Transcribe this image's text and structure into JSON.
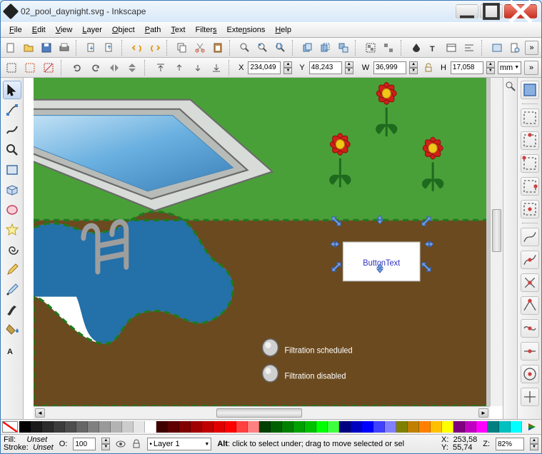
{
  "window": {
    "title": "02_pool_daynight.svg - Inkscape"
  },
  "menu": {
    "file": "File",
    "edit": "Edit",
    "view": "View",
    "layer": "Layer",
    "object": "Object",
    "path": "Path",
    "text": "Text",
    "filters": "Filters",
    "extensions": "Extensions",
    "help": "Help"
  },
  "tc": {
    "x_label": "X",
    "x": "234,049",
    "y_label": "Y",
    "y": "48,243",
    "w_label": "W",
    "w": "36,999",
    "h_label": "H",
    "h": "17,058",
    "unit": "mm"
  },
  "canvas": {
    "button_text": "ButtonText",
    "label1": "Filtration scheduled",
    "label2": "Filtration disabled"
  },
  "status": {
    "fill_label": "Fill:",
    "fill": "Unset",
    "stroke_label": "Stroke:",
    "stroke": "Unset",
    "o_label": "O:",
    "o": "100",
    "layer": "Layer 1",
    "hint": "Alt: click to select under; drag to move selected or sel",
    "cx_label": "X:",
    "cx": "253,58",
    "cy_label": "Y:",
    "cy": "55,74",
    "z_label": "Z:",
    "z": "82%"
  },
  "palette_colors": [
    "#000000",
    "#1a1a1a",
    "#2b2b2b",
    "#3c3c3c",
    "#4d4d4d",
    "#666666",
    "#808080",
    "#999999",
    "#b3b3b3",
    "#cccccc",
    "#e6e6e6",
    "#ffffff",
    "#400000",
    "#600000",
    "#800000",
    "#a00000",
    "#c00000",
    "#e00000",
    "#ff0000",
    "#ff4040",
    "#ff8080",
    "#004000",
    "#006000",
    "#008000",
    "#00a000",
    "#00c000",
    "#00ff00",
    "#40ff40",
    "#000080",
    "#0000c0",
    "#0000ff",
    "#4040ff",
    "#8080ff",
    "#808000",
    "#c08000",
    "#ff8000",
    "#ffc000",
    "#ffff00",
    "#800080",
    "#c000c0",
    "#ff00ff",
    "#008080",
    "#00c0c0",
    "#00ffff"
  ]
}
